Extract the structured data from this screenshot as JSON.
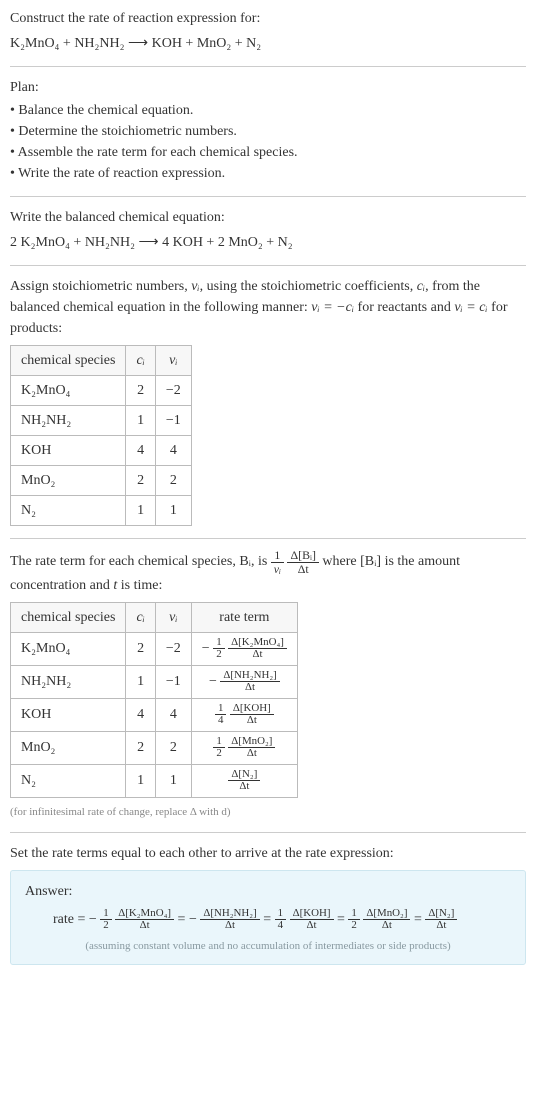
{
  "prompt": {
    "lead": "Construct the rate of reaction expression for:",
    "equation": "K₂MnO₄ + NH₂NH₂ ⟶ KOH + MnO₂ + N₂"
  },
  "plan": {
    "heading": "Plan:",
    "items": [
      "Balance the chemical equation.",
      "Determine the stoichiometric numbers.",
      "Assemble the rate term for each chemical species.",
      "Write the rate of reaction expression."
    ]
  },
  "balanced": {
    "lead": "Write the balanced chemical equation:",
    "equation": "2 K₂MnO₄ + NH₂NH₂ ⟶ 4 KOH + 2 MnO₂ + N₂"
  },
  "stoich": {
    "lead_a": "Assign stoichiometric numbers, ",
    "nu": "νᵢ",
    "lead_b": ", using the stoichiometric coefficients, ",
    "ci": "cᵢ",
    "lead_c": ", from the balanced chemical equation in the following manner: ",
    "rule_reactants": "νᵢ = −cᵢ",
    "for_reactants": " for reactants and ",
    "rule_products": "νᵢ = cᵢ",
    "for_products": " for products:",
    "headers": {
      "species": "chemical species",
      "c": "cᵢ",
      "nu": "νᵢ"
    },
    "rows": [
      {
        "species": "K₂MnO₄",
        "c": "2",
        "nu": "−2"
      },
      {
        "species": "NH₂NH₂",
        "c": "1",
        "nu": "−1"
      },
      {
        "species": "KOH",
        "c": "4",
        "nu": "4"
      },
      {
        "species": "MnO₂",
        "c": "2",
        "nu": "2"
      },
      {
        "species": "N₂",
        "c": "1",
        "nu": "1"
      }
    ]
  },
  "rateterm": {
    "lead_a": "The rate term for each chemical species, Bᵢ, is ",
    "frac1_num": "1",
    "frac1_den": "νᵢ",
    "frac2_num": "Δ[Bᵢ]",
    "frac2_den": "Δt",
    "lead_b": " where [Bᵢ] is the amount concentration and ",
    "t": "t",
    "lead_c": " is time:",
    "headers": {
      "species": "chemical species",
      "c": "cᵢ",
      "nu": "νᵢ",
      "rate": "rate term"
    },
    "rows": [
      {
        "species": "K₂MnO₄",
        "c": "2",
        "nu": "−2",
        "pre": "−",
        "coef_num": "1",
        "coef_den": "2",
        "dnum": "Δ[K₂MnO₄]",
        "dden": "Δt"
      },
      {
        "species": "NH₂NH₂",
        "c": "1",
        "nu": "−1",
        "pre": "−",
        "coef_num": "",
        "coef_den": "",
        "dnum": "Δ[NH₂NH₂]",
        "dden": "Δt"
      },
      {
        "species": "KOH",
        "c": "4",
        "nu": "4",
        "pre": "",
        "coef_num": "1",
        "coef_den": "4",
        "dnum": "Δ[KOH]",
        "dden": "Δt"
      },
      {
        "species": "MnO₂",
        "c": "2",
        "nu": "2",
        "pre": "",
        "coef_num": "1",
        "coef_den": "2",
        "dnum": "Δ[MnO₂]",
        "dden": "Δt"
      },
      {
        "species": "N₂",
        "c": "1",
        "nu": "1",
        "pre": "",
        "coef_num": "",
        "coef_den": "",
        "dnum": "Δ[N₂]",
        "dden": "Δt"
      }
    ],
    "note": "(for infinitesimal rate of change, replace Δ with d)"
  },
  "final": {
    "lead": "Set the rate terms equal to each other to arrive at the rate expression:",
    "answer_label": "Answer:",
    "rate_label": "rate = ",
    "terms": [
      {
        "pre": "−",
        "coef_num": "1",
        "coef_den": "2",
        "dnum": "Δ[K₂MnO₄]",
        "dden": "Δt"
      },
      {
        "pre": "−",
        "coef_num": "",
        "coef_den": "",
        "dnum": "Δ[NH₂NH₂]",
        "dden": "Δt"
      },
      {
        "pre": "",
        "coef_num": "1",
        "coef_den": "4",
        "dnum": "Δ[KOH]",
        "dden": "Δt"
      },
      {
        "pre": "",
        "coef_num": "1",
        "coef_den": "2",
        "dnum": "Δ[MnO₂]",
        "dden": "Δt"
      },
      {
        "pre": "",
        "coef_num": "",
        "coef_den": "",
        "dnum": "Δ[N₂]",
        "dden": "Δt"
      }
    ],
    "eq": " = ",
    "note": "(assuming constant volume and no accumulation of intermediates or side products)"
  }
}
